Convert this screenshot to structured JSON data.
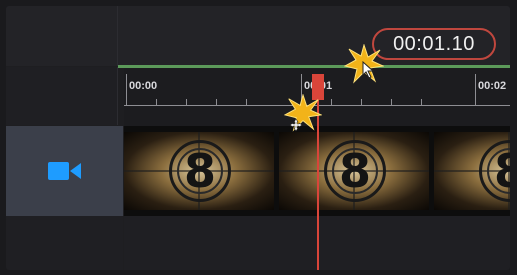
{
  "header": {
    "time_display": "00:01.10"
  },
  "ruler": {
    "labels": [
      "00:00",
      "00:01",
      "00:02"
    ]
  },
  "track": {
    "icon": "video-camera-icon",
    "frame_digit": "8"
  },
  "cursors": [
    "pointer-cursor-icon",
    "move-cursor-icon"
  ],
  "colors": {
    "accent_green": "#5c9a5a",
    "playhead_red": "#d9453a",
    "video_icon_blue": "#1e9cff"
  }
}
